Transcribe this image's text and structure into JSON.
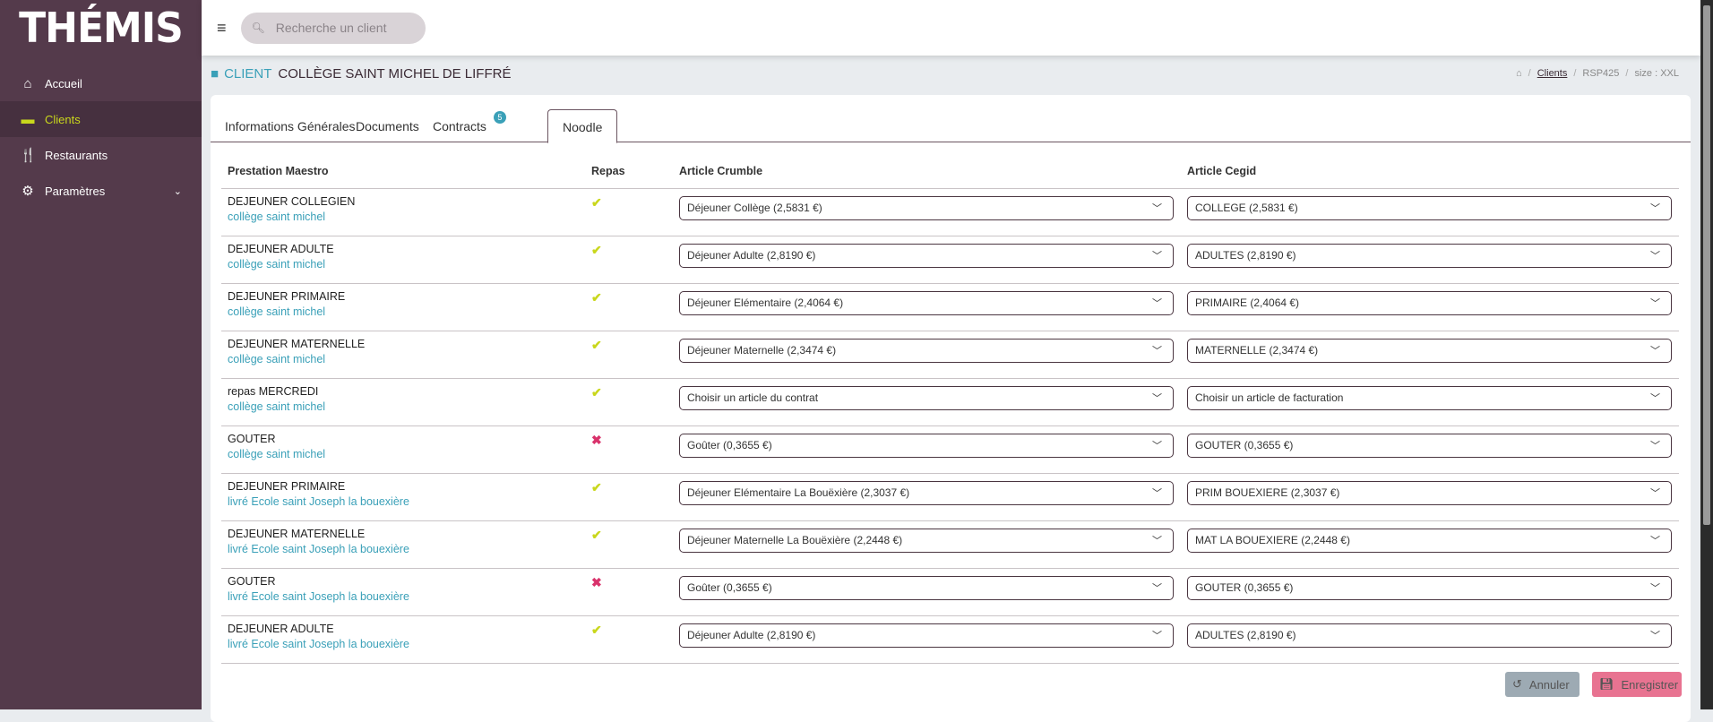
{
  "app": {
    "logo": "THÉMIS"
  },
  "sidebar": {
    "items": [
      {
        "label": "Accueil",
        "icon": "home-icon"
      },
      {
        "label": "Clients",
        "icon": "briefcase-icon"
      },
      {
        "label": "Restaurants",
        "icon": "utensils-icon"
      },
      {
        "label": "Paramètres",
        "icon": "gear-icon"
      }
    ]
  },
  "topbar": {
    "search_placeholder": "Recherche un client"
  },
  "header": {
    "label": "CLIENT",
    "name": "COLLÈGE SAINT MICHEL DE LIFFRÉ"
  },
  "breadcrumb": {
    "items": [
      "Clients",
      "RSP425",
      "size : XXL"
    ]
  },
  "tabs": [
    {
      "label": "Informations Générales"
    },
    {
      "label": "Documents"
    },
    {
      "label": "Contracts",
      "badge": "5"
    },
    {
      "label": "Noodle"
    }
  ],
  "table": {
    "headers": [
      "Prestation Maestro",
      "Repas",
      "Article Crumble",
      "Article Cegid"
    ],
    "rows": [
      {
        "name": "DEJEUNER COLLEGIEN",
        "site": "collège saint michel",
        "repas": true,
        "crumble": "Déjeuner Collège (2,5831 €)",
        "cegid": "COLLEGE (2,5831 €)"
      },
      {
        "name": "DEJEUNER ADULTE",
        "site": "collège saint michel",
        "repas": true,
        "crumble": "Déjeuner Adulte (2,8190 €)",
        "cegid": "ADULTES (2,8190 €)"
      },
      {
        "name": "DEJEUNER PRIMAIRE",
        "site": "collège saint michel",
        "repas": true,
        "crumble": "Déjeuner Elémentaire (2,4064 €)",
        "cegid": "PRIMAIRE (2,4064 €)"
      },
      {
        "name": "DEJEUNER MATERNELLE",
        "site": "collège saint michel",
        "repas": true,
        "crumble": "Déjeuner Maternelle (2,3474 €)",
        "cegid": "MATERNELLE (2,3474 €)"
      },
      {
        "name": "repas MERCREDI",
        "site": "collège saint michel",
        "repas": true,
        "crumble": "Choisir un article du contrat",
        "cegid": "Choisir un article de facturation"
      },
      {
        "name": "GOUTER",
        "site": "collège saint michel",
        "repas": false,
        "crumble": "Goûter (0,3655 €)",
        "cegid": "GOUTER (0,3655 €)"
      },
      {
        "name": "DEJEUNER PRIMAIRE",
        "site": "livré Ecole saint Joseph la bouexière",
        "repas": true,
        "crumble": "Déjeuner Elémentaire La Bouëxière (2,3037 €)",
        "cegid": "PRIM BOUEXIERE (2,3037 €)"
      },
      {
        "name": "DEJEUNER MATERNELLE",
        "site": "livré Ecole saint Joseph la bouexière",
        "repas": true,
        "crumble": "Déjeuner Maternelle La Bouëxière (2,2448 €)",
        "cegid": "MAT LA BOUEXIERE (2,2448 €)"
      },
      {
        "name": "GOUTER",
        "site": "livré Ecole saint Joseph la bouexière",
        "repas": false,
        "crumble": "Goûter (0,3655 €)",
        "cegid": "GOUTER (0,3655 €)"
      },
      {
        "name": "DEJEUNER ADULTE",
        "site": "livré Ecole saint Joseph la bouexière",
        "repas": true,
        "crumble": "Déjeuner Adulte (2,8190 €)",
        "cegid": "ADULTES (2,8190 €)"
      }
    ]
  },
  "actions": {
    "cancel": "Annuler",
    "save": "Enregistrer"
  },
  "colors": {
    "sidebar": "#543a4b",
    "accent": "#3aa0b8",
    "active": "#c9d71c",
    "danger": "#d9326b"
  }
}
